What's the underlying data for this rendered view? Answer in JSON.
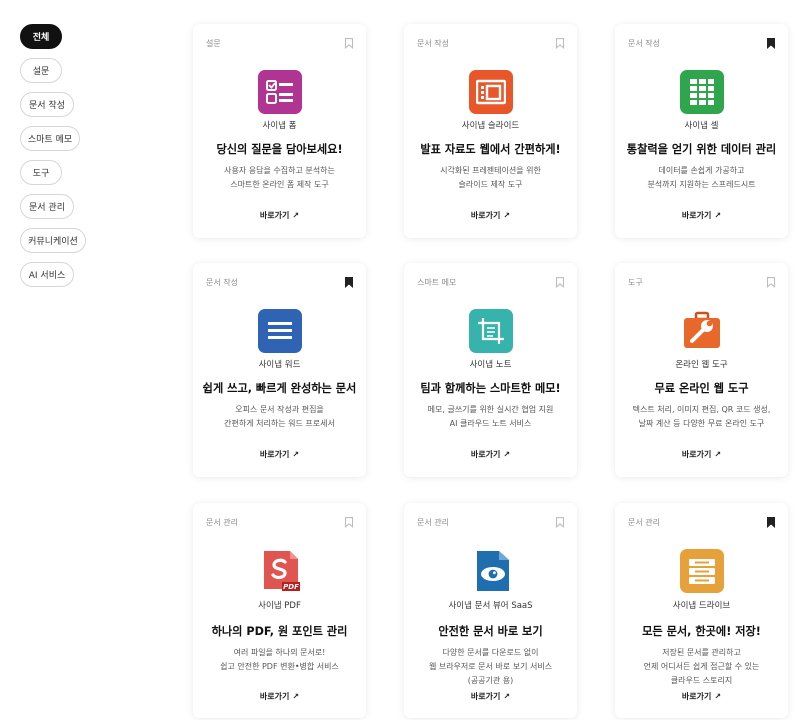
{
  "filters": [
    "전체",
    "설문",
    "문서 작성",
    "스마트 메모",
    "도구",
    "문서 관리",
    "커뮤니케이션",
    "AI 서비스"
  ],
  "active_filter": "전체",
  "go_label": "바로가기",
  "go_arrow": "↗",
  "cards": [
    {
      "category": "설문",
      "bookmarked": false,
      "icon": "form-icon",
      "color": "#b03592",
      "name": "사이냅 폼",
      "headline": "당신의 질문을 담아보세요!",
      "desc": [
        "사용자 응답을 수집하고 분석하는",
        "스마트한 온라인 폼 제작 도구"
      ]
    },
    {
      "category": "문서 작성",
      "bookmarked": false,
      "icon": "slide-icon",
      "color": "#e8562a",
      "name": "사이냅 슬라이드",
      "headline": "발표 자료도 웹에서 간편하게!",
      "desc": [
        "시각화된 프레젠테이션을 위한",
        "슬라이드 제작 도구"
      ]
    },
    {
      "category": "문서 작성",
      "bookmarked": true,
      "icon": "spreadsheet-icon",
      "color": "#2fa64e",
      "name": "사이냅 셀",
      "headline": "통찰력을 얻기 위한 데이터 관리",
      "desc": [
        "데이터를 손쉽게 가공하고",
        "분석까지 지원하는 스프레드시트"
      ]
    },
    {
      "category": "문서 작성",
      "bookmarked": true,
      "icon": "word-icon",
      "color": "#2f64b5",
      "name": "사이냅 워드",
      "headline": "쉽게 쓰고, 빠르게 완성하는 문서",
      "desc": [
        "오피스 문서 작성과 편집을",
        "간편하게 처리하는 워드 프로세서"
      ]
    },
    {
      "category": "스마트 메모",
      "bookmarked": false,
      "icon": "note-icon",
      "color": "#36b3ad",
      "name": "사이냅 노트",
      "headline": "팀과 함께하는 스마트한 메모!",
      "desc": [
        "메모, 글쓰기를 위한 실시간 협업 지원",
        "AI 클라우드 노트 서비스"
      ]
    },
    {
      "category": "도구",
      "bookmarked": false,
      "icon": "toolbox-icon",
      "color": "#e8672a",
      "name": "온라인 웹 도구",
      "headline": "무료 온라인 웹 도구",
      "desc": [
        "텍스트 처리, 이미지 편집, QR 코드 생성,",
        "날짜 계산 등 다양한 무료 온라인 도구"
      ]
    },
    {
      "category": "문서 관리",
      "bookmarked": false,
      "icon": "pdf-icon",
      "color": "#e0504b",
      "name": "사이냅 PDF",
      "headline": "하나의 PDF, 원 포인트 관리",
      "desc": [
        "여러 파일을 하나의 문서로!",
        "쉽고 안전한 PDF 변환•병합 서비스"
      ]
    },
    {
      "category": "문서 관리",
      "bookmarked": false,
      "icon": "viewer-icon",
      "color": "#1f6fb0",
      "name": "사이냅 문서 뷰어 SaaS",
      "headline": "안전한 문서 바로 보기",
      "desc": [
        "다양한 문서를 다운로드 없이",
        "웹 브라우저로 문서 바로 보기 서비스",
        "(공공기관 용)"
      ]
    },
    {
      "category": "문서 관리",
      "bookmarked": true,
      "icon": "drive-icon",
      "color": "#e6a13a",
      "name": "사이냅 드라이브",
      "headline": "모든 문서, 한곳에! 저장!",
      "desc": [
        "저장된 문서를 관리하고",
        "언제 어디서든 쉽게 접근할 수 있는",
        "클라우드 스토리지"
      ]
    }
  ]
}
